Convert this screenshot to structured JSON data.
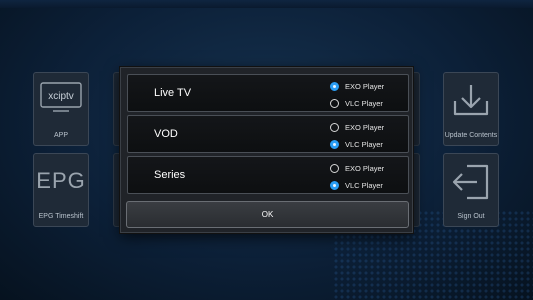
{
  "tiles": {
    "app": {
      "label": "APP",
      "logo_text": "xciptv",
      "icon": "xciptv-logo-icon"
    },
    "epg": {
      "label": "EPG Timeshift",
      "logo_text": "EPG",
      "icon": "epg-text-icon"
    },
    "update": {
      "label": "Update Contents",
      "icon": "download-icon"
    },
    "signout": {
      "label": "Sign Out",
      "icon": "sign-out-icon"
    }
  },
  "dialog": {
    "rows": [
      {
        "label": "Live TV",
        "options": [
          {
            "label": "EXO Player",
            "selected": true
          },
          {
            "label": "VLC Player",
            "selected": false
          }
        ]
      },
      {
        "label": "VOD",
        "options": [
          {
            "label": "EXO Player",
            "selected": false
          },
          {
            "label": "VLC Player",
            "selected": true
          }
        ]
      },
      {
        "label": "Series",
        "options": [
          {
            "label": "EXO Player",
            "selected": false
          },
          {
            "label": "VLC Player",
            "selected": true
          }
        ]
      }
    ],
    "ok_label": "OK"
  },
  "colors": {
    "accent": "#2a9df4",
    "background": "#0a1a2e",
    "dialog_bg": "#202328"
  }
}
